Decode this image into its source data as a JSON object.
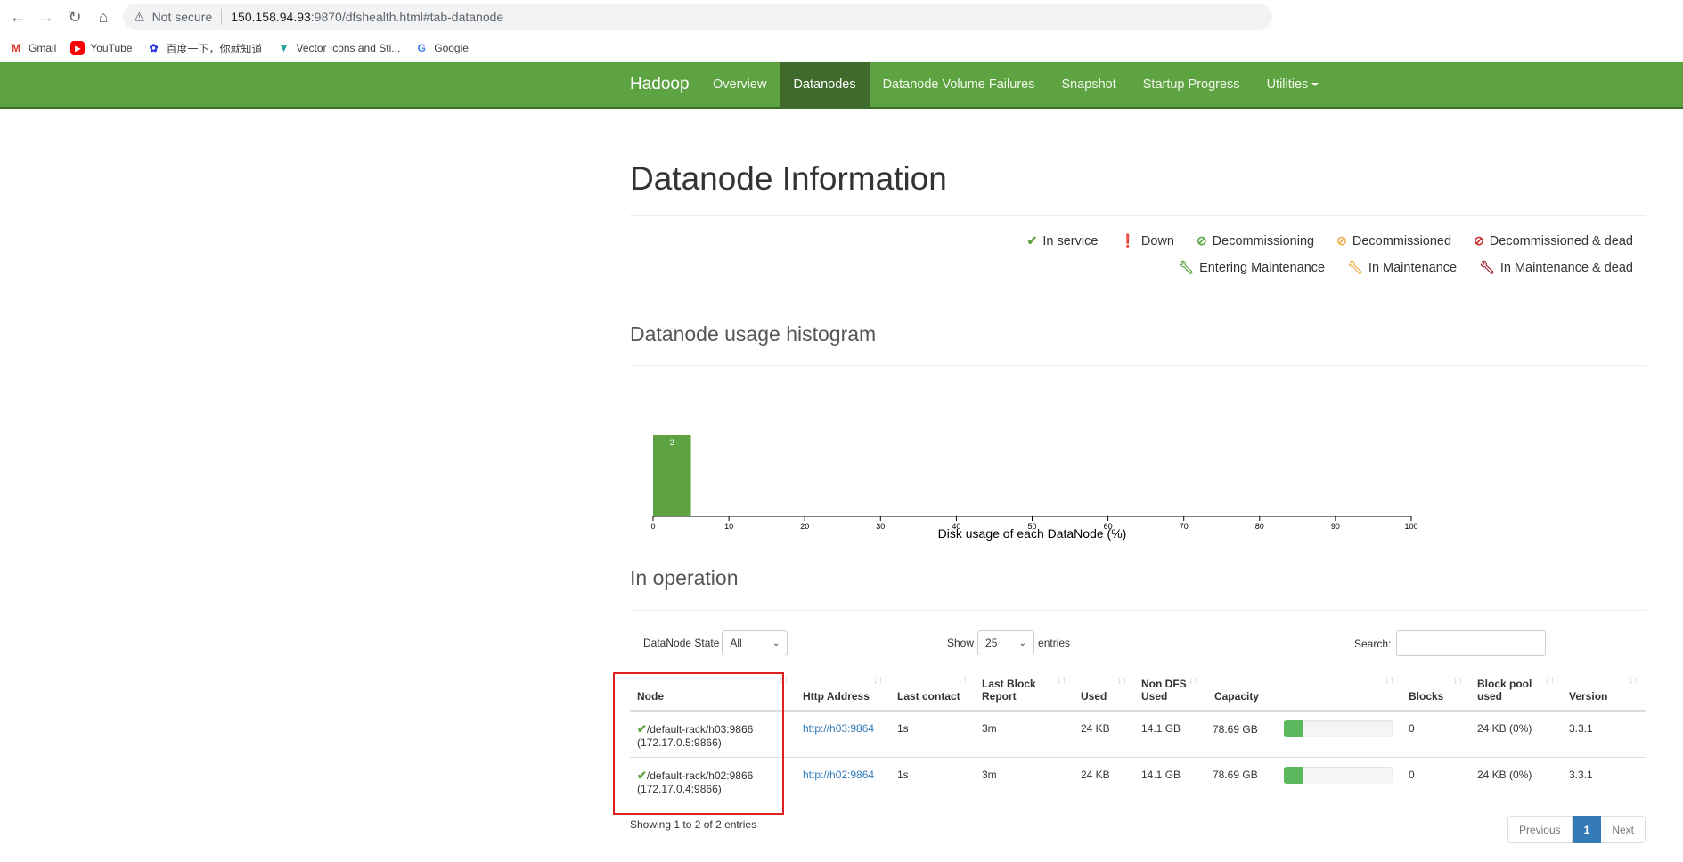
{
  "browser": {
    "security_label": "Not secure",
    "url_host": "150.158.94.93",
    "url_path": ":9870/dfshealth.html#tab-datanode",
    "bookmarks": [
      {
        "label": "Gmail",
        "icon": "gmail-icon"
      },
      {
        "label": "YouTube",
        "icon": "youtube-icon"
      },
      {
        "label": "百度一下，你就知道",
        "icon": "baidu-icon"
      },
      {
        "label": "Vector Icons and Sti...",
        "icon": "vector-icon"
      },
      {
        "label": "Google",
        "icon": "google-icon"
      }
    ]
  },
  "navbar": {
    "brand": "Hadoop",
    "items": [
      {
        "label": "Overview",
        "active": false
      },
      {
        "label": "Datanodes",
        "active": true
      },
      {
        "label": "Datanode Volume Failures",
        "active": false
      },
      {
        "label": "Snapshot",
        "active": false
      },
      {
        "label": "Startup Progress",
        "active": false
      },
      {
        "label": "Utilities",
        "active": false,
        "dropdown": true
      }
    ]
  },
  "page": {
    "title": "Datanode Information",
    "legend_row1": [
      {
        "label": "In service",
        "icon": "check-icon",
        "color": "#5ea342"
      },
      {
        "label": "Down",
        "icon": "exclamation-icon",
        "color": "#c9302c"
      },
      {
        "label": "Decommissioning",
        "icon": "ban-icon",
        "color": "#5ea342"
      },
      {
        "label": "Decommissioned",
        "icon": "ban-icon",
        "color": "#f0ad4e"
      },
      {
        "label": "Decommissioned & dead",
        "icon": "ban-icon",
        "color": "#c9302c"
      }
    ],
    "legend_row2": [
      {
        "label": "Entering Maintenance",
        "icon": "wrench-icon",
        "color": "#5ea342"
      },
      {
        "label": "In Maintenance",
        "icon": "wrench-icon",
        "color": "#f0ad4e"
      },
      {
        "label": "In Maintenance & dead",
        "icon": "wrench-icon",
        "color": "#a02030"
      }
    ],
    "histogram_heading": "Datanode usage histogram",
    "operation_heading": "In operation"
  },
  "chart_data": {
    "type": "bar",
    "title": "",
    "xlabel": "Disk usage of each DataNode (%)",
    "ylabel": "",
    "xlim": [
      0,
      100
    ],
    "x_ticks": [
      0,
      10,
      20,
      30,
      40,
      50,
      60,
      70,
      80,
      90,
      100
    ],
    "bins": [
      {
        "x0": 0,
        "x1": 5,
        "count": 2
      }
    ],
    "bar_color": "#5ea342"
  },
  "controls": {
    "state_label": "DataNode State",
    "state_value": "All",
    "show_label": "Show",
    "entries_value": "25",
    "entries_label": "entries",
    "search_label": "Search:"
  },
  "table": {
    "columns": [
      "Node",
      "Http Address",
      "Last contact",
      "Last Block Report",
      "Used",
      "Non DFS Used",
      "Capacity",
      "Blocks",
      "Block pool used",
      "Version"
    ],
    "rows": [
      {
        "node": "/default-rack/h03:9866",
        "ip": "(172.17.0.5:9866)",
        "http": "http://h03:9864",
        "last_contact": "1s",
        "last_block_report": "3m",
        "used": "24 KB",
        "non_dfs_used": "14.1 GB",
        "capacity": "78.69 GB",
        "capacity_fraction": 0.18,
        "blocks": "0",
        "block_pool_used": "24 KB (0%)",
        "version": "3.3.1"
      },
      {
        "node": "/default-rack/h02:9866",
        "ip": "(172.17.0.4:9866)",
        "http": "http://h02:9864",
        "last_contact": "1s",
        "last_block_report": "3m",
        "used": "24 KB",
        "non_dfs_used": "14.1 GB",
        "capacity": "78.69 GB",
        "capacity_fraction": 0.18,
        "blocks": "0",
        "block_pool_used": "24 KB (0%)",
        "version": "3.3.1"
      }
    ],
    "info": "Showing 1 to 2 of 2 entries",
    "pager": {
      "prev": "Previous",
      "current": "1",
      "next": "Next"
    }
  }
}
